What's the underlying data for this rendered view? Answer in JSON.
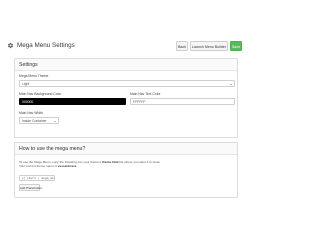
{
  "header": {
    "title": "Mega Menu Settings",
    "icon": "gear-icon",
    "buttons": {
      "back": "Back",
      "launch": "Launch Menu Builder",
      "save": "Save"
    }
  },
  "settings": {
    "heading": "Settings",
    "theme": {
      "label": "Mega Menu Theme",
      "value": "Light"
    },
    "nav_bg": {
      "label": "Main Nav Background Color",
      "value": "000000"
    },
    "nav_text": {
      "label": "Main Nav Text Color",
      "value": "FFFFFF"
    },
    "nav_width": {
      "label": "Main Nav Width",
      "value": "Inside Container"
    }
  },
  "howto": {
    "heading": "How to use the mega menu?",
    "line1_start": "To use the Mega Menu, copy the following into your theme's",
    "line1_file": "theme.html",
    "line1_end": "file where you want it to show.",
    "line2_start": "Your current theme name is",
    "line2_theme": "vessenbrace",
    "code": "{{ store | mega_menu }}",
    "copy_button": "Add Placeholder"
  },
  "colors": {
    "save_button": "#5cb85c",
    "nav_bg_field": "#000000"
  }
}
